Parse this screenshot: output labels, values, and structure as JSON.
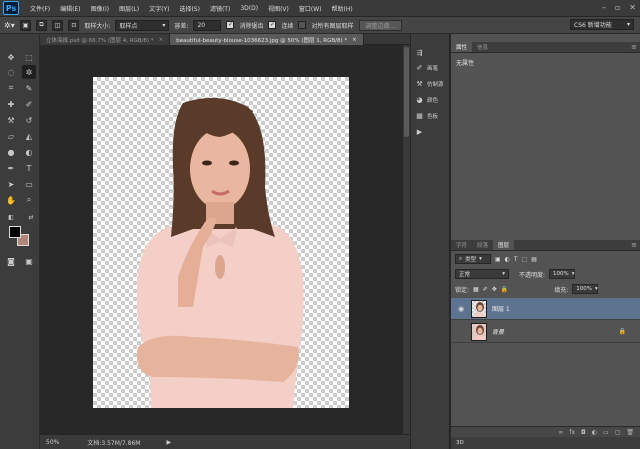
{
  "app": {
    "logo": "Ps"
  },
  "menus": [
    "文件(F)",
    "编辑(E)",
    "图像(I)",
    "图层(L)",
    "文字(Y)",
    "选择(S)",
    "滤镜(T)",
    "3D(D)",
    "视图(V)",
    "窗口(W)",
    "帮助(H)"
  ],
  "options": {
    "sample_size_label": "取样大小:",
    "sample_size_value": "取样点",
    "tolerance_label": "容差:",
    "tolerance_value": "20",
    "antialias_label": "消除锯齿",
    "contiguous_label": "连续",
    "sample_all_label": "对所有图层取样",
    "refine_edge_label": "调整边缘...",
    "workspace": "CS6 新增功能"
  },
  "tabs": [
    {
      "label": "立体海报.psd @ 66.7% (图层 4, RGB/8) *",
      "close": "×"
    },
    {
      "label": "beautiful-beauty-blouse-1036623.jpg @ 50% (图层 1, RGB/8) *",
      "close": "×"
    }
  ],
  "status": {
    "zoom": "50%",
    "doc": "文档:3.57M/7.86M"
  },
  "mini_panel": {
    "items": [
      "",
      "画笔",
      "仿制源",
      "颜色",
      "色板"
    ]
  },
  "properties": {
    "tabs": [
      "属性",
      "信息"
    ],
    "content": "无属性"
  },
  "layers": {
    "tabs": [
      "字符",
      "段落",
      "图层"
    ],
    "filter_kind": "类型",
    "blend_mode": "正常",
    "opacity_label": "不透明度:",
    "opacity_value": "100%",
    "lock_label": "锁定:",
    "fill_label": "填充:",
    "fill_value": "100%",
    "items": [
      {
        "name": "图层 1",
        "selected": true
      },
      {
        "name": "背景",
        "selected": false
      }
    ]
  },
  "bottom_tab": "3D",
  "colors": {
    "foreground": "#000000",
    "background": "#b3867a",
    "selected_layer": "#5e7390"
  }
}
